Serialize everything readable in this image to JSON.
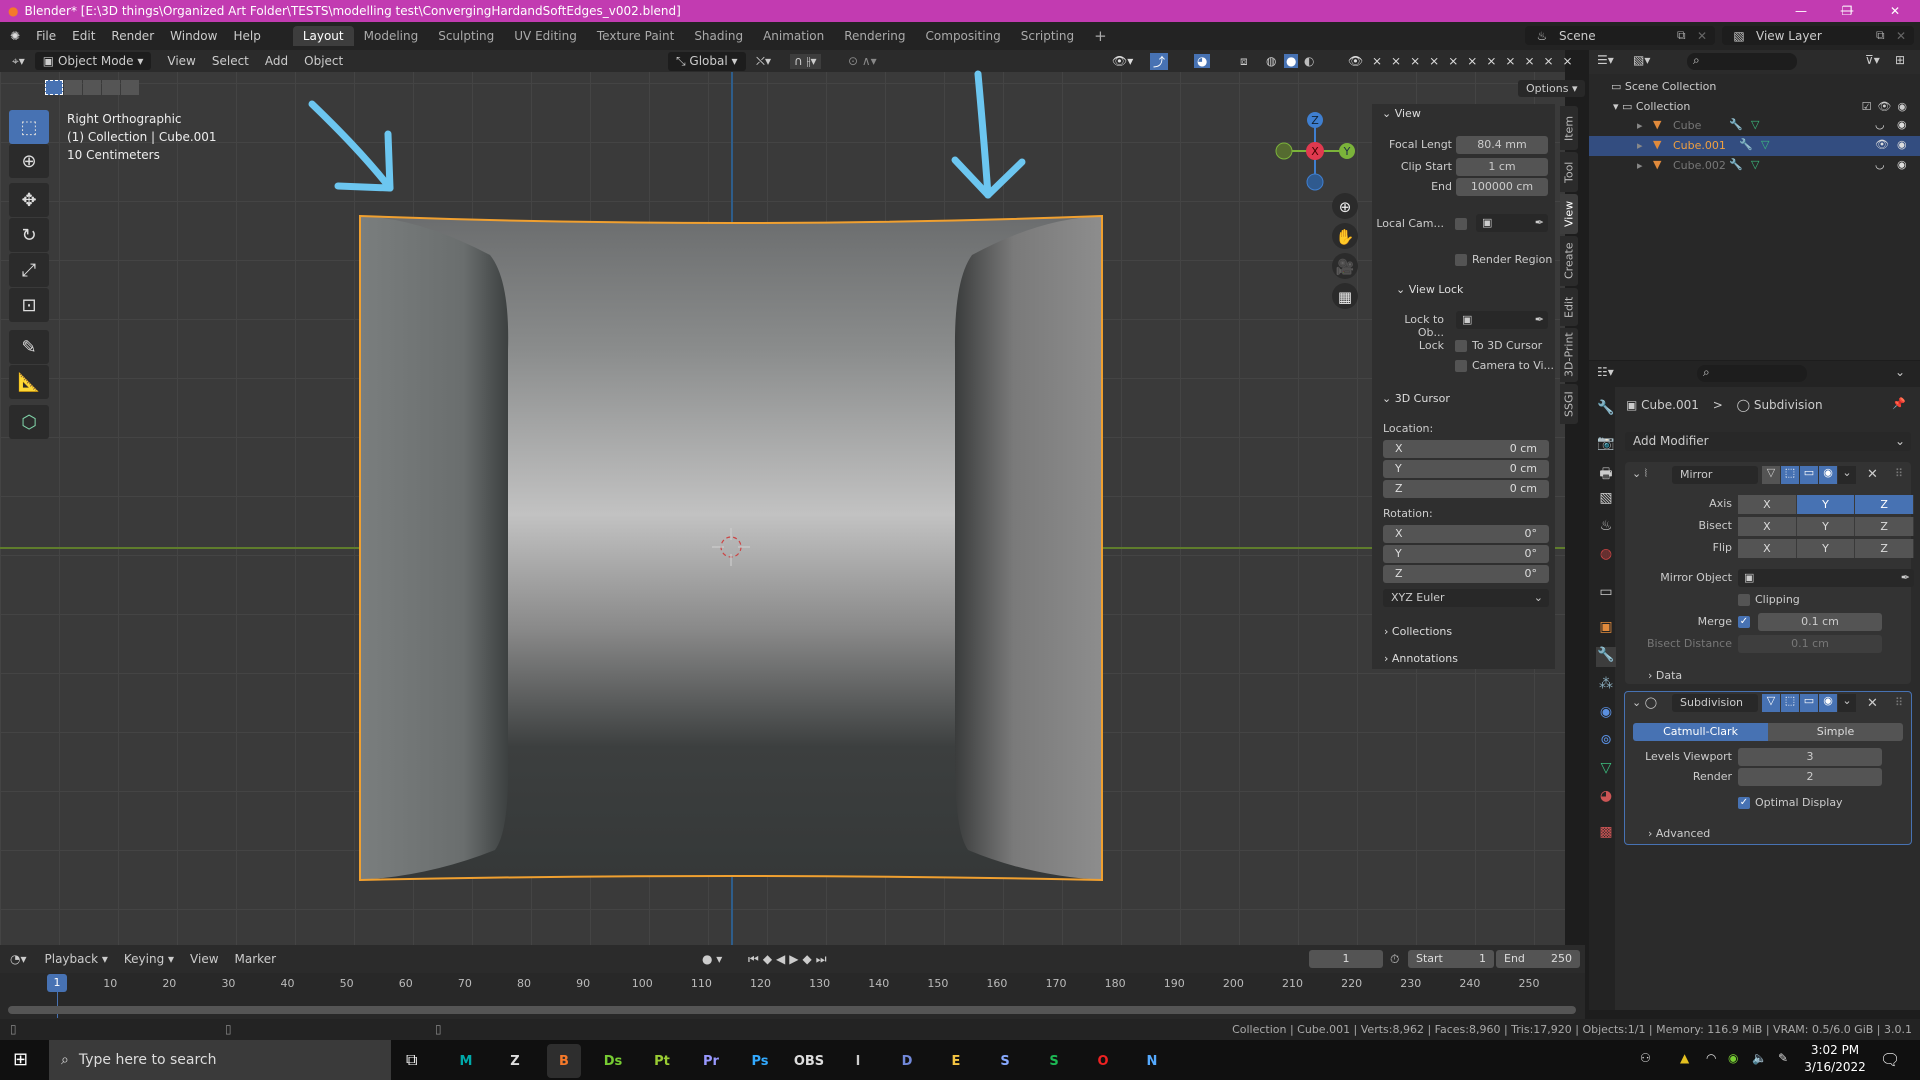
{
  "window": {
    "title": "Blender* [E:\\3D things\\Organized Art Folder\\TESTS\\modelling test\\ConvergingHardandSoftEdges_v002.blend]",
    "minimize": "—",
    "restore": "❐",
    "close": "✕"
  },
  "menu": {
    "items": [
      "File",
      "Edit",
      "Render",
      "Window",
      "Help"
    ],
    "workspaces": [
      "Layout",
      "Modeling",
      "Sculpting",
      "UV Editing",
      "Texture Paint",
      "Shading",
      "Animation",
      "Rendering",
      "Compositing",
      "Scripting"
    ],
    "add_workspace": "+",
    "scene": "Scene",
    "view_layer": "View Layer"
  },
  "viewport_header": {
    "mode": "Object Mode",
    "menus": [
      "View",
      "Select",
      "Add",
      "Object"
    ],
    "orientation": "Global",
    "options": "Options"
  },
  "viewport": {
    "view_name": "Right Orthographic",
    "collection_info": "(1) Collection | Cube.001",
    "scale": "10 Centimeters",
    "gizmo": {
      "x": "X",
      "y": "Y",
      "z": "Z"
    },
    "annotation_color": "#6cc6f0",
    "object_outline_color": "#f0a030"
  },
  "npanel": {
    "tabs": [
      "Item",
      "Tool",
      "View",
      "Create",
      "Edit",
      "3D-Print",
      "SSGI"
    ],
    "active_tab": "View",
    "view": {
      "title": "View",
      "focal_label": "Focal Lengt",
      "focal": "80.4 mm",
      "clip_start_label": "Clip Start",
      "clip_start": "1 cm",
      "end_label": "End",
      "end": "100000 cm",
      "local_cam_label": "Local Cam...",
      "render_region": "Render Region"
    },
    "view_lock": {
      "title": "View Lock",
      "lock_to_label": "Lock to Ob...",
      "lock_label": "Lock",
      "to_cursor": "To 3D Cursor",
      "camera_to_view": "Camera to Vi..."
    },
    "cursor": {
      "title": "3D Cursor",
      "location_label": "Location:",
      "loc": [
        {
          "axis": "X",
          "value": "0 cm"
        },
        {
          "axis": "Y",
          "value": "0 cm"
        },
        {
          "axis": "Z",
          "value": "0 cm"
        }
      ],
      "rotation_label": "Rotation:",
      "rot": [
        {
          "axis": "X",
          "value": "0°"
        },
        {
          "axis": "Y",
          "value": "0°"
        },
        {
          "axis": "Z",
          "value": "0°"
        }
      ],
      "rotation_mode": "XYZ Euler"
    },
    "collections": "Collections",
    "annotations": "Annotations"
  },
  "outliner": {
    "scene_collection": "Scene Collection",
    "collection": "Collection",
    "objects": [
      {
        "name": "Cube",
        "selected": false,
        "visible": false
      },
      {
        "name": "Cube.001",
        "selected": true,
        "visible": true
      },
      {
        "name": "Cube.002",
        "selected": false,
        "visible": false
      }
    ]
  },
  "properties": {
    "breadcrumb_object": "Cube.001",
    "breadcrumb_sep": ">",
    "breadcrumb_modifier": "Subdivision",
    "add_modifier": "Add Modifier",
    "mirror": {
      "name": "Mirror",
      "axis_label": "Axis",
      "bisect_label": "Bisect",
      "flip_label": "Flip",
      "axes": [
        "X",
        "Y",
        "Z"
      ],
      "axis_on": [
        false,
        true,
        true
      ],
      "mirror_object_label": "Mirror Object",
      "clipping": "Clipping",
      "merge_label": "Merge",
      "merge_checked": true,
      "merge": "0.1 cm",
      "bisect_distance_label": "Bisect Distance",
      "bisect_distance": "0.1 cm",
      "data": "Data"
    },
    "subdivision": {
      "name": "Subdivision",
      "catmull": "Catmull-Clark",
      "simple": "Simple",
      "levels_label": "Levels Viewport",
      "levels": "3",
      "render_label": "Render",
      "render": "2",
      "optimal_display": "Optimal Display",
      "optimal_checked": true,
      "advanced": "Advanced"
    }
  },
  "timeline": {
    "menus": [
      "Playback",
      "Keying",
      "View",
      "Marker"
    ],
    "current_frame": "1",
    "start_label": "Start",
    "start": "1",
    "end_label": "End",
    "end": "250",
    "ticks": [
      "10",
      "20",
      "30",
      "40",
      "50",
      "60",
      "70",
      "80",
      "90",
      "100",
      "110",
      "120",
      "130",
      "140",
      "150",
      "160",
      "170",
      "180",
      "190",
      "200",
      "210",
      "220",
      "230",
      "240",
      "250"
    ],
    "playhead": "1"
  },
  "statusbar": {
    "text": "Collection | Cube.001 | Verts:8,962 | Faces:8,960 | Tris:17,920 | Objects:1/1 | Memory: 116.9 MiB | VRAM: 0.5/6.0 GiB | 3.0.1"
  },
  "taskbar": {
    "search_placeholder": "Type here to search",
    "apps": [
      "M",
      "Z",
      "Blender",
      "Ds",
      "Pt",
      "Pr",
      "Ps",
      "OBS",
      "live",
      "Discord",
      "Explorer",
      "Steam",
      "Spotify",
      "Opera",
      "Notepad"
    ],
    "time": "3:02 PM",
    "date": "3/16/2022"
  }
}
